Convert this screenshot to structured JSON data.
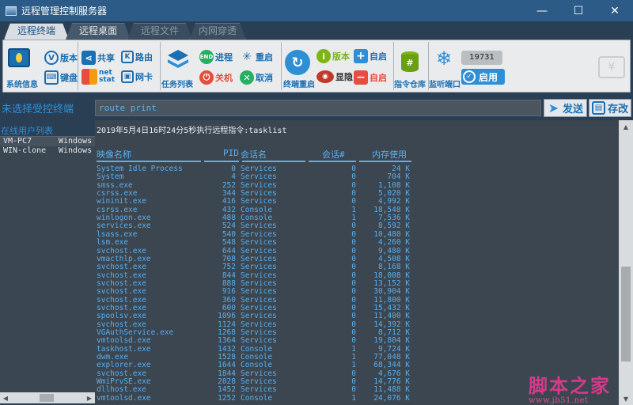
{
  "window": {
    "title": "远程管理控制服务器",
    "minimize_glyph": "—",
    "maximize_glyph": "☐",
    "close_glyph": "✕"
  },
  "tabs": [
    {
      "label": "远程终端",
      "state": "active"
    },
    {
      "label": "远程桌面",
      "state": "normal"
    },
    {
      "label": "远程文件",
      "state": "disabled"
    },
    {
      "label": "内网穿透",
      "state": "disabled"
    }
  ],
  "toolbar": {
    "system_info": "系统信息",
    "version": "版本",
    "keyboard": "键盘",
    "share": "共享",
    "route": "路由",
    "net_stat_line1": "net",
    "net_stat_line2": "stat",
    "nic": "网卡",
    "task_list": "任务列表",
    "process": "进程",
    "restart": "重启",
    "shutdown": "关机",
    "cancel": "取消",
    "terminal_restart": "终端重启",
    "client_version": "版本",
    "autostart_on": "自启",
    "show_hide": "显隐",
    "autostart_off": "自启",
    "cmd_store": "指令仓库",
    "listen_port": "监听端口",
    "port_value": "19731",
    "enable": "启用"
  },
  "command": {
    "target_label": "未选择受控终端",
    "input_value": "route print",
    "send_label": "发送",
    "save_label": "存改"
  },
  "hosts": {
    "title": "在线用户列表",
    "items": [
      {
        "name": "VM-PC7",
        "os": "Windows"
      },
      {
        "name": "WIN-clone",
        "os": "Windows"
      }
    ]
  },
  "output": {
    "exec_line": "2019年5月4日16时24分5秒执行远程指令:tasklist",
    "columns": {
      "image": "映像名称",
      "pid": "PID",
      "session": "会话名",
      "session_no": "会话#",
      "mem": "内存使用"
    },
    "rows": [
      {
        "image": "System Idle Process",
        "pid": "0",
        "session": "Services",
        "session_no": "0",
        "mem": "24 K"
      },
      {
        "image": "System",
        "pid": "4",
        "session": "Services",
        "session_no": "0",
        "mem": "704 K"
      },
      {
        "image": "smss.exe",
        "pid": "252",
        "session": "Services",
        "session_no": "0",
        "mem": "1,108 K"
      },
      {
        "image": "csrss.exe",
        "pid": "344",
        "session": "Services",
        "session_no": "0",
        "mem": "5,020 K"
      },
      {
        "image": "wininit.exe",
        "pid": "416",
        "session": "Services",
        "session_no": "0",
        "mem": "4,992 K"
      },
      {
        "image": "csrss.exe",
        "pid": "432",
        "session": "Console",
        "session_no": "1",
        "mem": "18,548 K"
      },
      {
        "image": "winlogon.exe",
        "pid": "488",
        "session": "Console",
        "session_no": "1",
        "mem": "7,536 K"
      },
      {
        "image": "services.exe",
        "pid": "524",
        "session": "Services",
        "session_no": "0",
        "mem": "8,592 K"
      },
      {
        "image": "lsass.exe",
        "pid": "540",
        "session": "Services",
        "session_no": "0",
        "mem": "10,480 K"
      },
      {
        "image": "lsm.exe",
        "pid": "548",
        "session": "Services",
        "session_no": "0",
        "mem": "4,260 K"
      },
      {
        "image": "svchost.exe",
        "pid": "644",
        "session": "Services",
        "session_no": "0",
        "mem": "9,480 K"
      },
      {
        "image": "vmacthlp.exe",
        "pid": "708",
        "session": "Services",
        "session_no": "0",
        "mem": "4,508 K"
      },
      {
        "image": "svchost.exe",
        "pid": "752",
        "session": "Services",
        "session_no": "0",
        "mem": "8,168 K"
      },
      {
        "image": "svchost.exe",
        "pid": "844",
        "session": "Services",
        "session_no": "0",
        "mem": "18,008 K"
      },
      {
        "image": "svchost.exe",
        "pid": "888",
        "session": "Services",
        "session_no": "0",
        "mem": "13,152 K"
      },
      {
        "image": "svchost.exe",
        "pid": "916",
        "session": "Services",
        "session_no": "0",
        "mem": "30,904 K"
      },
      {
        "image": "svchost.exe",
        "pid": "360",
        "session": "Services",
        "session_no": "0",
        "mem": "11,800 K"
      },
      {
        "image": "svchost.exe",
        "pid": "600",
        "session": "Services",
        "session_no": "0",
        "mem": "15,432 K"
      },
      {
        "image": "spoolsv.exe",
        "pid": "1096",
        "session": "Services",
        "session_no": "0",
        "mem": "11,400 K"
      },
      {
        "image": "svchost.exe",
        "pid": "1124",
        "session": "Services",
        "session_no": "0",
        "mem": "14,392 K"
      },
      {
        "image": "VGAuthService.exe",
        "pid": "1268",
        "session": "Services",
        "session_no": "0",
        "mem": "8,712 K"
      },
      {
        "image": "vmtoolsd.exe",
        "pid": "1364",
        "session": "Services",
        "session_no": "0",
        "mem": "19,804 K"
      },
      {
        "image": "taskhost.exe",
        "pid": "1432",
        "session": "Console",
        "session_no": "1",
        "mem": "9,724 K"
      },
      {
        "image": "dwm.exe",
        "pid": "1528",
        "session": "Console",
        "session_no": "1",
        "mem": "77,048 K"
      },
      {
        "image": "explorer.exe",
        "pid": "1644",
        "session": "Console",
        "session_no": "1",
        "mem": "68,344 K"
      },
      {
        "image": "svchost.exe",
        "pid": "1844",
        "session": "Services",
        "session_no": "0",
        "mem": "4,676 K"
      },
      {
        "image": "WmiPrvSE.exe",
        "pid": "2028",
        "session": "Services",
        "session_no": "0",
        "mem": "14,776 K"
      },
      {
        "image": "dllhost.exe",
        "pid": "1452",
        "session": "Services",
        "session_no": "0",
        "mem": "11,488 K"
      },
      {
        "image": "vmtoolsd.exe",
        "pid": "1252",
        "session": "Console",
        "session_no": "1",
        "mem": "24,076 K"
      }
    ]
  },
  "watermark": {
    "line1": "脚本之家",
    "line2": "www.jb51.net"
  },
  "colors": {
    "accent": "#1b6fb3",
    "terminal_text": "#58aef0",
    "title_bar": "#2b5b86"
  }
}
